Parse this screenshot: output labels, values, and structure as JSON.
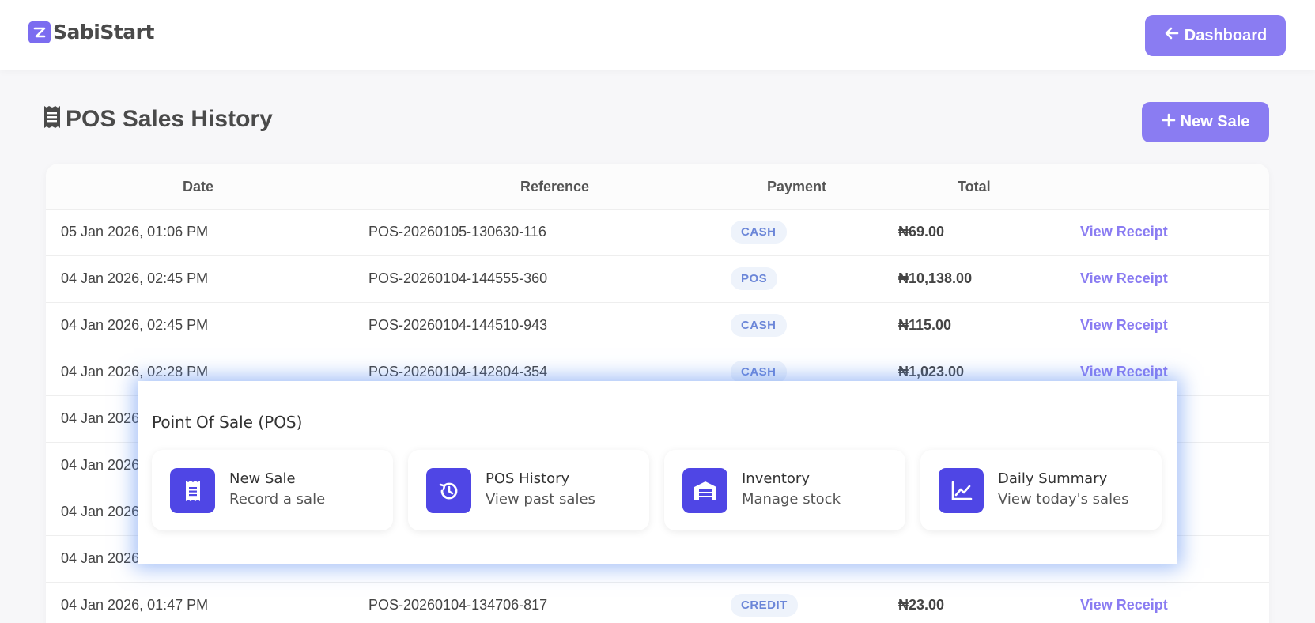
{
  "header": {
    "brand": "SabiStart",
    "dashboard_label": "Dashboard"
  },
  "page": {
    "title": "POS Sales History",
    "new_sale_label": "New Sale"
  },
  "table": {
    "columns": [
      "Date",
      "Reference",
      "Payment",
      "Total"
    ],
    "rows": [
      {
        "date": "05 Jan 2026, 01:06 PM",
        "reference": "POS-20260105-130630-116",
        "payment": "CASH",
        "total": "₦69.00",
        "action": "View Receipt"
      },
      {
        "date": "04 Jan 2026, 02:45 PM",
        "reference": "POS-20260104-144555-360",
        "payment": "POS",
        "total": "₦10,138.00",
        "action": "View Receipt"
      },
      {
        "date": "04 Jan 2026, 02:45 PM",
        "reference": "POS-20260104-144510-943",
        "payment": "CASH",
        "total": "₦115.00",
        "action": "View Receipt"
      },
      {
        "date": "04 Jan 2026, 02:28 PM",
        "reference": "POS-20260104-142804-354",
        "payment": "CASH",
        "total": "₦1,023.00",
        "action": "View Receipt"
      },
      {
        "date": "04 Jan 2026",
        "reference": "",
        "payment": "",
        "total": "",
        "action": ""
      },
      {
        "date": "04 Jan 2026",
        "reference": "",
        "payment": "",
        "total": "",
        "action": ""
      },
      {
        "date": "04 Jan 2026",
        "reference": "",
        "payment": "",
        "total": "",
        "action": ""
      },
      {
        "date": "04 Jan 2026",
        "reference": "",
        "payment": "",
        "total": "",
        "action": ""
      },
      {
        "date": "04 Jan 2026, 01:47 PM",
        "reference": "POS-20260104-134706-817",
        "payment": "CREDIT",
        "total": "₦23.00",
        "action": "View Receipt"
      }
    ]
  },
  "pos_menu": {
    "title": "Point Of Sale (POS)",
    "tiles": [
      {
        "title": "New Sale",
        "subtitle": "Record a sale",
        "icon": "receipt-icon"
      },
      {
        "title": "POS History",
        "subtitle": "View past sales",
        "icon": "history-icon"
      },
      {
        "title": "Inventory",
        "subtitle": "Manage stock",
        "icon": "warehouse-icon"
      },
      {
        "title": "Daily Summary",
        "subtitle": "View today's sales",
        "icon": "chart-line-icon"
      }
    ]
  },
  "colors": {
    "accent": "#8a7cf2",
    "tile_icon_bg": "#4f46e5",
    "modal_glow": "#5a8cf0",
    "badge_bg": "#eef3fb",
    "badge_text": "#6b86d8"
  }
}
